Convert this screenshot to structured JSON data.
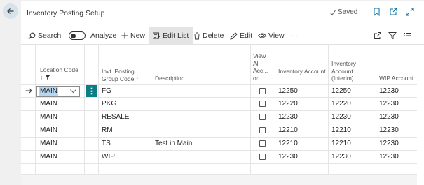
{
  "page": {
    "title": "Inventory Posting Setup",
    "saved_label": "Saved"
  },
  "toolbar": {
    "search": "Search",
    "analyze": "Analyze",
    "new": "New",
    "edit_list": "Edit List",
    "delete": "Delete",
    "edit": "Edit",
    "view": "View",
    "more": "···"
  },
  "columns": {
    "location_code": "Location Code",
    "location_sort": "↑",
    "invt_group_line1": "Invt. Posting",
    "invt_group_line2": "Group Code ↑",
    "description": "Description",
    "view_all_1": "View",
    "view_all_2": "All",
    "view_all_3": "Acc...",
    "view_all_4": "on",
    "inv_account": "Inventory Account",
    "inv_interim_1": "Inventory",
    "inv_interim_2": "Account",
    "inv_interim_3": "(Interim)",
    "wip_account": "WIP Account"
  },
  "rows": [
    {
      "location": "MAIN",
      "group": "FG",
      "description": "",
      "inv": "12250",
      "interim": "12250",
      "wip": "12230"
    },
    {
      "location": "MAIN",
      "group": "PKG",
      "description": "",
      "inv": "12220",
      "interim": "12220",
      "wip": "12230"
    },
    {
      "location": "MAIN",
      "group": "RESALE",
      "description": "",
      "inv": "12230",
      "interim": "12230",
      "wip": "12230"
    },
    {
      "location": "MAIN",
      "group": "RM",
      "description": "",
      "inv": "12210",
      "interim": "12210",
      "wip": "12230"
    },
    {
      "location": "MAIN",
      "group": "TS",
      "description": "Test in Main",
      "inv": "12210",
      "interim": "12210",
      "wip": "12230"
    },
    {
      "location": "MAIN",
      "group": "WIP",
      "description": "",
      "inv": "12230",
      "interim": "12230",
      "wip": "12230"
    }
  ],
  "icons": {
    "back": "back-arrow-icon",
    "bookmark": "bookmark-icon",
    "open_new": "open-in-new-window-icon",
    "expand": "expand-icon",
    "share": "share-icon",
    "filter": "filter-icon",
    "list": "list-view-icon"
  },
  "colors": {
    "accent": "#0a7d86",
    "selection": "#b7d7f0",
    "back_button_bg": "#d7e3ea"
  }
}
